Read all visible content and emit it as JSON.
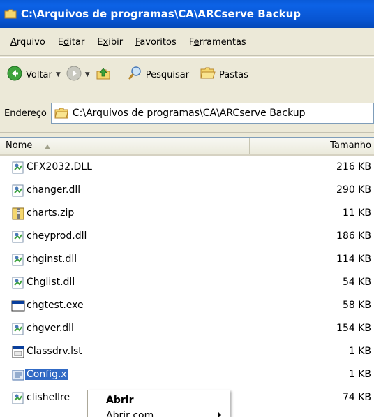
{
  "window": {
    "title": "C:\\Arquivos de programas\\CA\\ARCserve Backup"
  },
  "menu": {
    "items": [
      "Arquivo",
      "Editar",
      "Exibir",
      "Favoritos",
      "Ferramentas"
    ]
  },
  "toolbar": {
    "back_label": "Voltar",
    "search_label": "Pesquisar",
    "folders_label": "Pastas"
  },
  "address": {
    "label": "Endereço",
    "value": "C:\\Arquivos de programas\\CA\\ARCserve Backup"
  },
  "columns": {
    "name": "Nome",
    "size": "Tamanho"
  },
  "files": [
    {
      "name": "CFX2032.DLL",
      "size": "216 KB",
      "icon": "dll-icon"
    },
    {
      "name": "changer.dll",
      "size": "290 KB",
      "icon": "dll-icon"
    },
    {
      "name": "charts.zip",
      "size": "11 KB",
      "icon": "zip-icon"
    },
    {
      "name": "cheyprod.dll",
      "size": "186 KB",
      "icon": "dll-icon"
    },
    {
      "name": "chginst.dll",
      "size": "114 KB",
      "icon": "dll-icon"
    },
    {
      "name": "Chglist.dll",
      "size": "54 KB",
      "icon": "dll-icon"
    },
    {
      "name": "chgtest.exe",
      "size": "58 KB",
      "icon": "exe-icon"
    },
    {
      "name": "chgver.dll",
      "size": "154 KB",
      "icon": "dll-icon"
    },
    {
      "name": "Classdrv.lst",
      "size": "1 KB",
      "icon": "lst-icon"
    },
    {
      "name": "Config.x",
      "size": "1 KB",
      "icon": "config-icon",
      "selected": true
    },
    {
      "name": "clishellre",
      "size": "74 KB",
      "icon": "dll-icon"
    }
  ],
  "context_menu": {
    "open_label": "Abrir",
    "open_with_label": "Abrir com"
  },
  "colors": {
    "title_bar": "#0a5ad8",
    "selection": "#316ac5",
    "chrome": "#ece9d8"
  }
}
